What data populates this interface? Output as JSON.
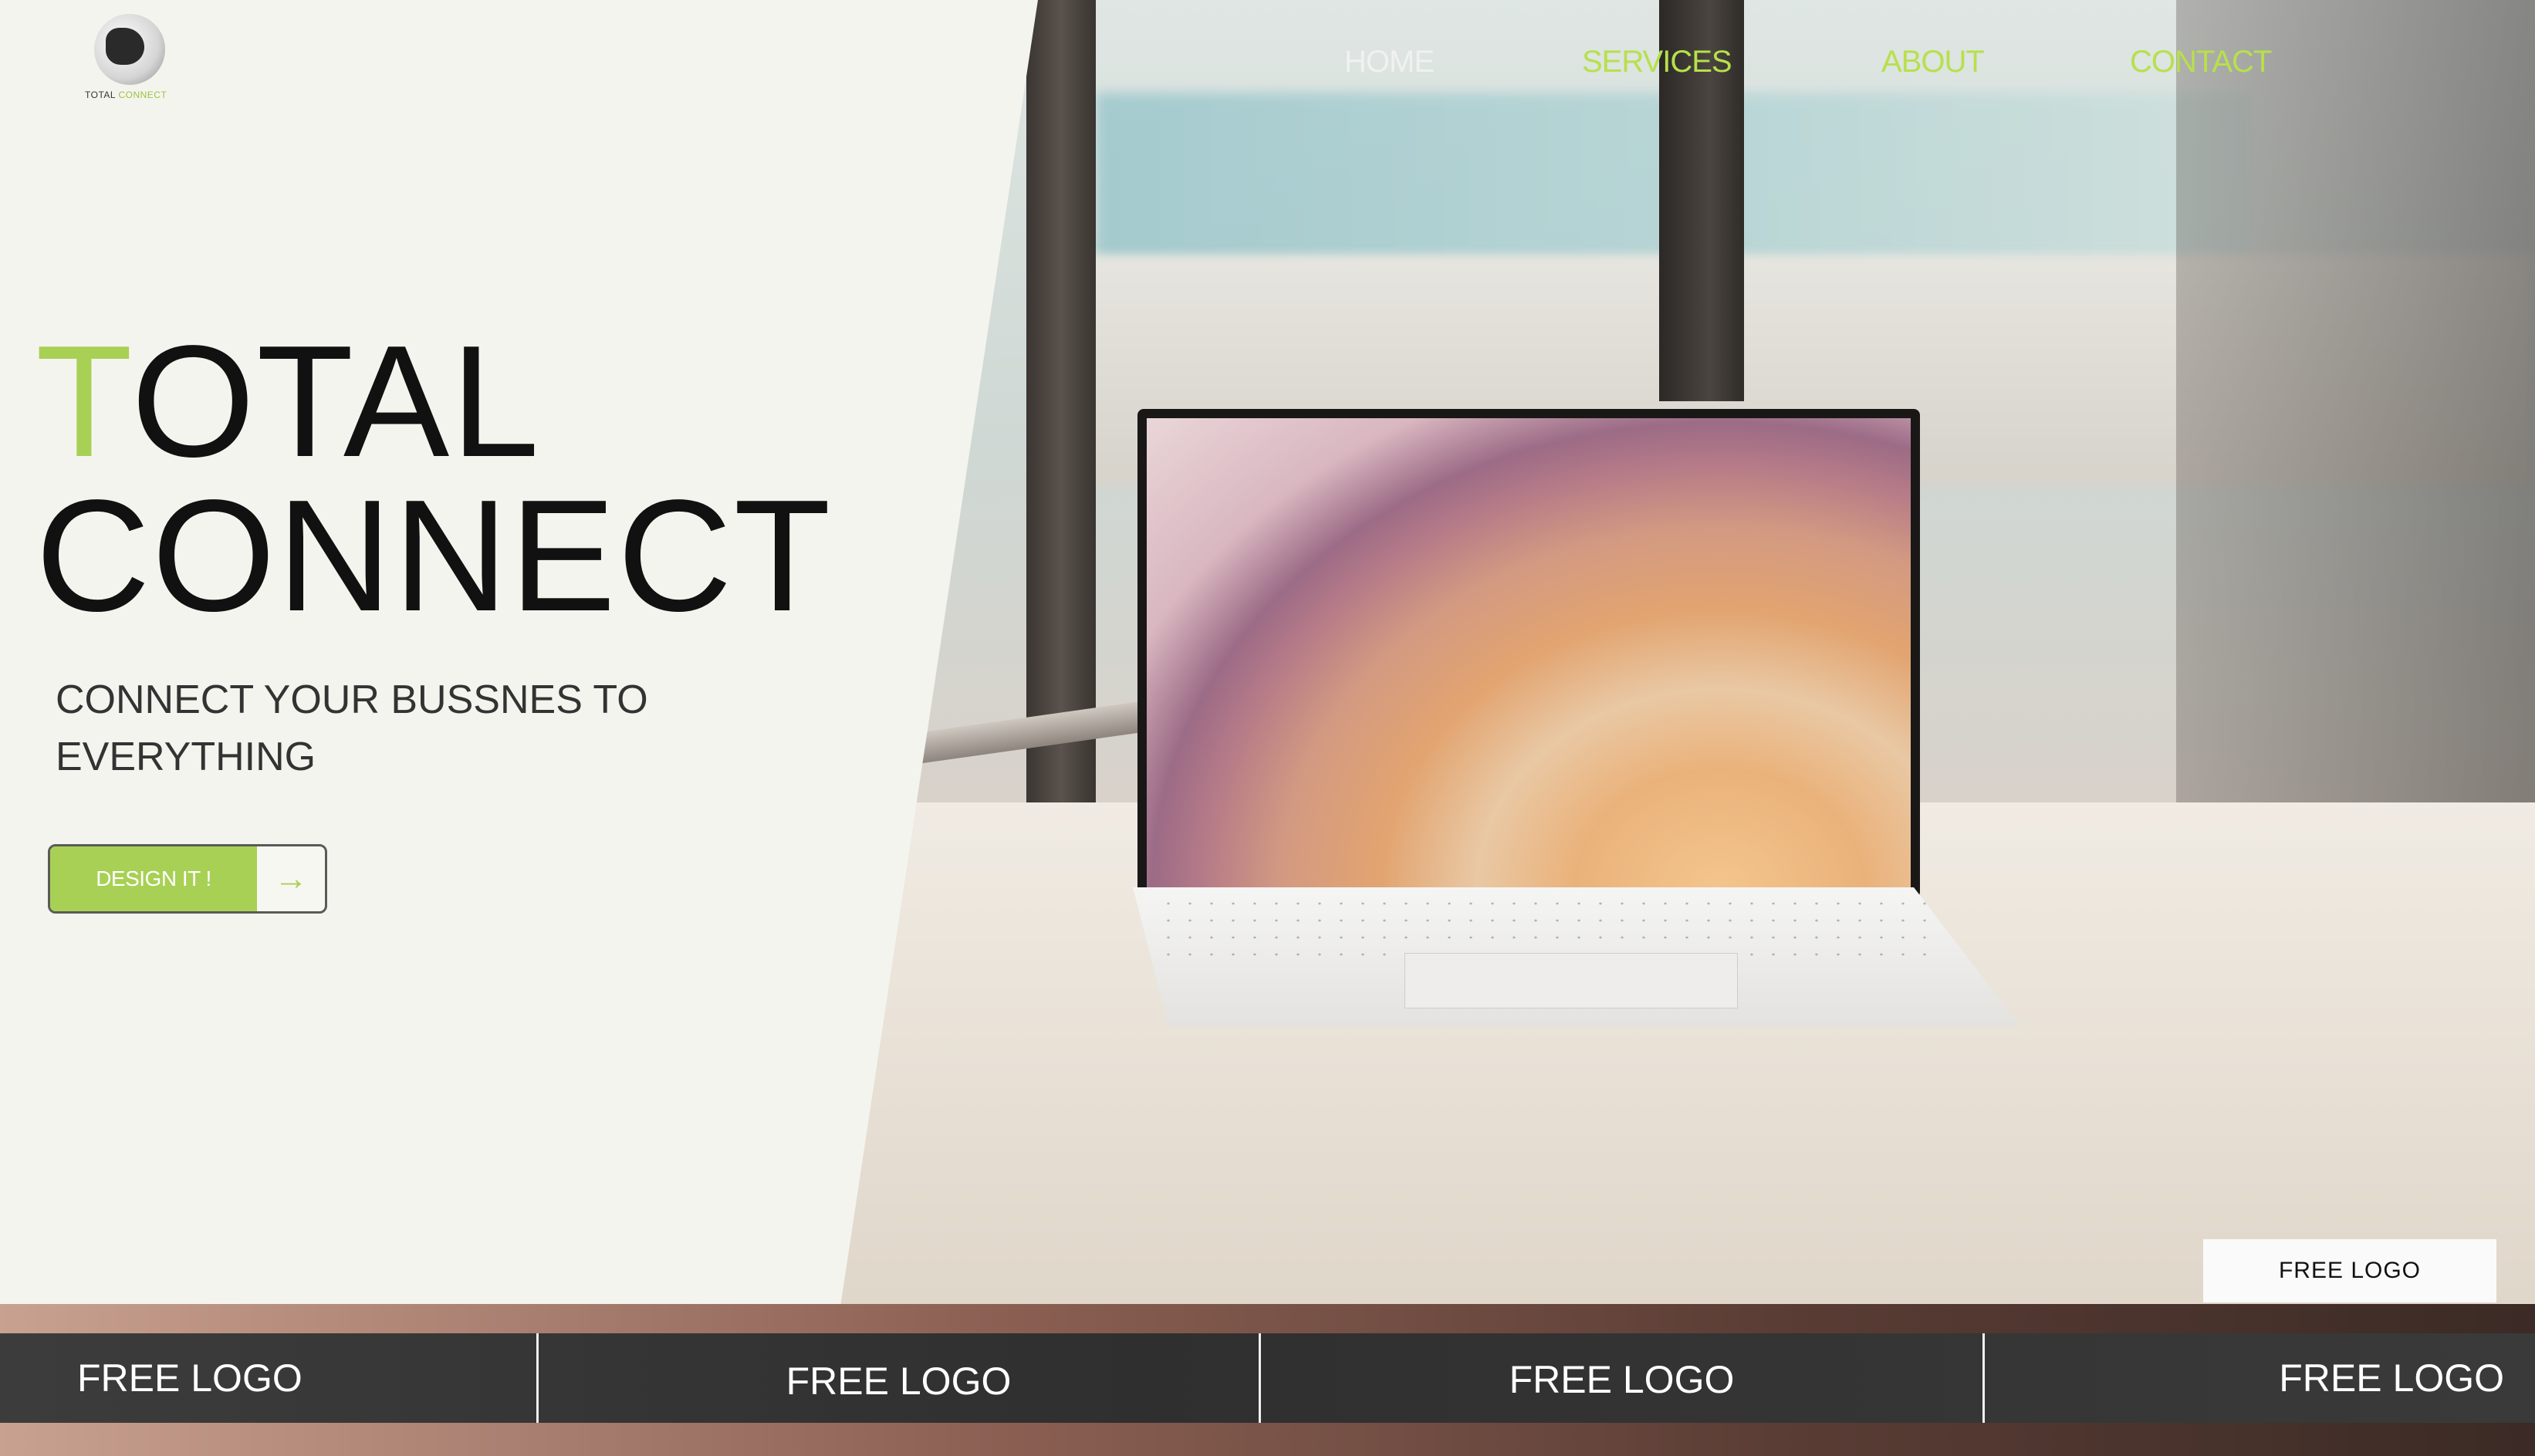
{
  "brand": {
    "logo_text_1": "TOTAL",
    "logo_text_2": "CONNECT",
    "accent_color": "#a8d054"
  },
  "nav": {
    "home": "HOME",
    "services": "SERVICES",
    "about": "ABOUT",
    "contact": "CONTACT"
  },
  "hero": {
    "title_accent": "T",
    "title_rest_line1": "OTAL",
    "title_line2": "CONNECT",
    "subtitle": "CONNECT YOUR BUSSNES TO EVERYTHING",
    "cta_label": "DESIGN IT !",
    "cta_icon": "arrow-right-icon"
  },
  "partner_box": {
    "label": "FREE LOGO"
  },
  "logo_strip": {
    "items": [
      "FREE LOGO",
      "FREE LOGO",
      "FREE LOGO",
      "FREE LOGO"
    ]
  }
}
